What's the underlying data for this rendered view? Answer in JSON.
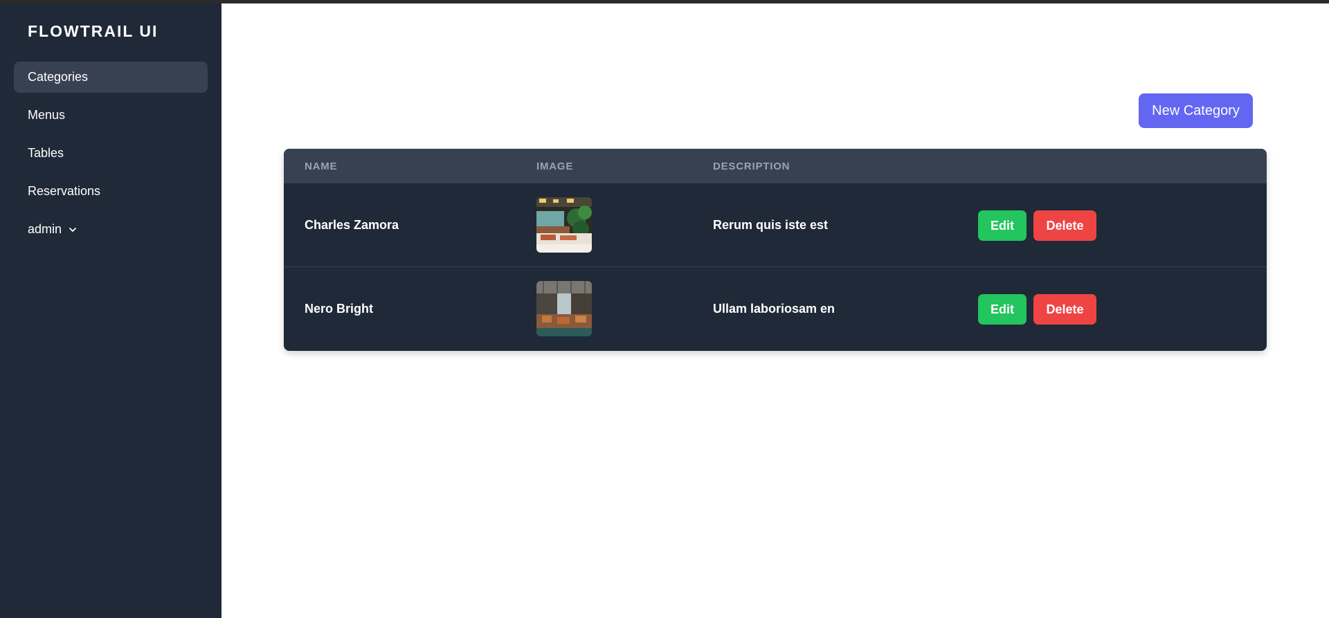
{
  "app": {
    "brand": "FLOWTRAIL UI"
  },
  "sidebar": {
    "items": [
      {
        "label": "Categories",
        "active": true
      },
      {
        "label": "Menus",
        "active": false
      },
      {
        "label": "Tables",
        "active": false
      },
      {
        "label": "Reservations",
        "active": false
      },
      {
        "label": "admin",
        "active": false,
        "icon": "chevron-down-icon"
      }
    ]
  },
  "toolbar": {
    "new_label": "New Category"
  },
  "table": {
    "columns": [
      "NAME",
      "IMAGE",
      "DESCRIPTION",
      ""
    ],
    "rows": [
      {
        "name": "Charles Zamora",
        "image": "restaurant-interior-thumbnail",
        "description": "Rerum quis iste est",
        "edit_label": "Edit",
        "delete_label": "Delete"
      },
      {
        "name": "Nero Bright",
        "image": "restaurant-hall-thumbnail",
        "description": "Ullam laboriosam en",
        "edit_label": "Edit",
        "delete_label": "Delete"
      }
    ]
  },
  "colors": {
    "sidebar_bg": "#1f2937",
    "active_item_bg": "#374151",
    "table_header_bg": "#374151",
    "primary": "#6366f1",
    "edit": "#22c55e",
    "delete": "#ef4444"
  }
}
